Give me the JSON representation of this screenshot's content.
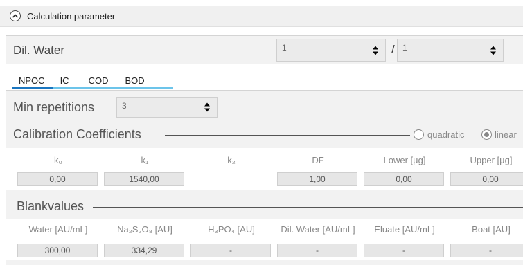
{
  "header": {
    "title": "Calculation parameter",
    "collapse_icon": "chevron-up-circle-icon"
  },
  "dil_water": {
    "label": "Dil. Water",
    "value1": "1",
    "separator": "/",
    "value2": "1"
  },
  "tabs": [
    {
      "label": "NPOC",
      "active": true
    },
    {
      "label": "IC",
      "active": false
    },
    {
      "label": "COD",
      "active": false
    },
    {
      "label": "BOD",
      "active": false
    }
  ],
  "min_repetitions": {
    "label": "Min repetitions",
    "value": "3"
  },
  "calibration": {
    "title": "Calibration Coefficients",
    "mode_options": [
      {
        "label": "quadratic",
        "selected": false
      },
      {
        "label": "linear",
        "selected": true
      }
    ],
    "headers": [
      "k₀",
      "k₁",
      "k₂",
      "DF",
      "Lower [µg]",
      "Upper [µg]"
    ],
    "values": [
      "0,00",
      "1540,00",
      "",
      "1,00",
      "0,00",
      "0,00"
    ]
  },
  "blankvalues": {
    "title": "Blankvalues",
    "headers": [
      "Water [AU/mL]",
      "Na₂S₂O₈ [AU]",
      "H₃PO₄ [AU]",
      "Dil. Water [AU/mL]",
      "Eluate [AU/mL]",
      "Boat [AU]"
    ],
    "values": [
      "300,00",
      "334,29",
      "-",
      "-",
      "-",
      "-"
    ]
  },
  "colors": {
    "tab_active": "#1a76c0",
    "tab_underline": "#6cc4ea",
    "panel_bg": "#f2f2f2"
  }
}
